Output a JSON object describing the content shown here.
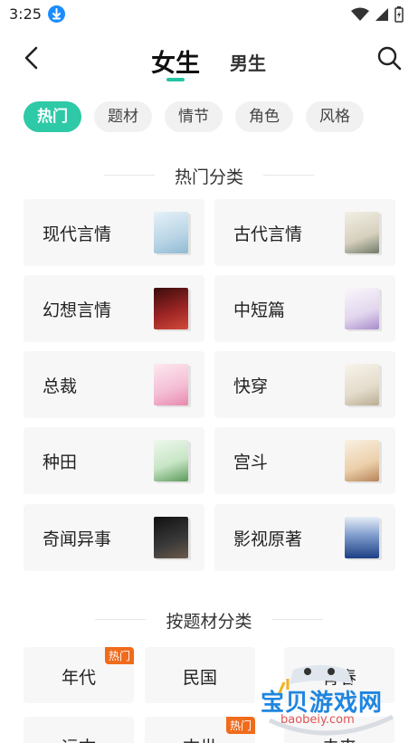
{
  "status": {
    "time": "3:25"
  },
  "header": {
    "tab_female": "女生",
    "tab_male": "男生"
  },
  "chips": [
    "热门",
    "题材",
    "情节",
    "角色",
    "风格"
  ],
  "section_hot": "热门分类",
  "categories": [
    {
      "label": "现代言情",
      "cover": "#cfe3ef"
    },
    {
      "label": "古代言情",
      "cover": "#e9e6da"
    },
    {
      "label": "幻想言情",
      "cover": "#7a1e1e"
    },
    {
      "label": "中短篇",
      "cover": "#f0ebf6"
    },
    {
      "label": "总裁",
      "cover": "#f6d6e4"
    },
    {
      "label": "快穿",
      "cover": "#efe9dd"
    },
    {
      "label": "种田",
      "cover": "#dff0df"
    },
    {
      "label": "宫斗",
      "cover": "#f0e1cf"
    },
    {
      "label": "奇闻异事",
      "cover": "#2a2a2a"
    },
    {
      "label": "影视原著",
      "cover": "#2c4f8f"
    }
  ],
  "section_subject": "按题材分类",
  "subjects": [
    {
      "label": "年代",
      "badge": "热门"
    },
    {
      "label": "民国",
      "badge": ""
    },
    {
      "label": "青春",
      "badge": ""
    },
    {
      "label": "远古",
      "badge": ""
    },
    {
      "label": "末世",
      "badge": "热门"
    },
    {
      "label": "未来",
      "badge": ""
    }
  ],
  "watermark": {
    "title": "宝贝游戏网",
    "url": "baobeiy.com"
  },
  "colors": {
    "accent": "#2ec9a7",
    "badge": "#f06b1c"
  }
}
